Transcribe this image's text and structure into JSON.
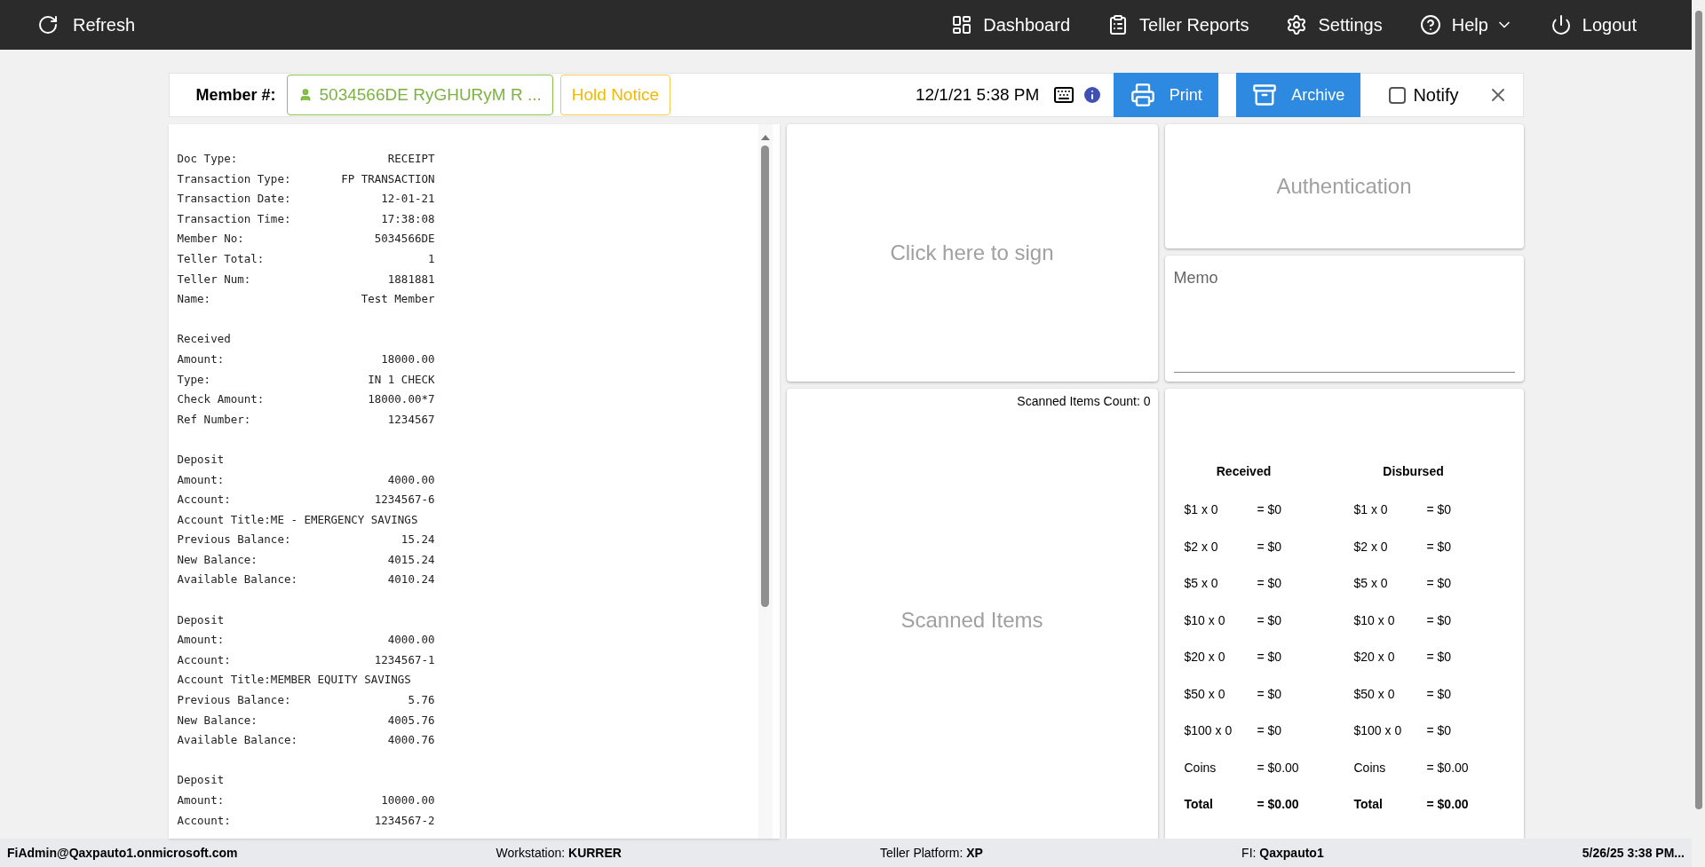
{
  "nav": {
    "refresh": "Refresh",
    "items": [
      {
        "kind": "dashboard",
        "label": "Dashboard"
      },
      {
        "kind": "reports",
        "label": "Teller Reports"
      },
      {
        "kind": "settings",
        "label": "Settings"
      },
      {
        "kind": "help",
        "label": "Help"
      },
      {
        "kind": "logout",
        "label": "Logout"
      }
    ]
  },
  "member_bar": {
    "label": "Member #:",
    "member": "5034566DE RyGHURyM R ...",
    "hold_notice": "Hold Notice",
    "datetime": "12/1/21 5:38 PM",
    "print": "Print",
    "archive": "Archive",
    "notify": {
      "label": "Notify",
      "checked": false
    }
  },
  "receipt": {
    "sections": [
      {
        "lines": [
          {
            "kind": "pair",
            "label": "Doc Type:",
            "value": "RECEIPT"
          },
          {
            "kind": "pair",
            "label": "Transaction Type:",
            "value": "FP TRANSACTION"
          },
          {
            "kind": "pair",
            "label": "Transaction Date:",
            "value": "12-01-21"
          },
          {
            "kind": "pair",
            "label": "Transaction Time:",
            "value": "17:38:08"
          },
          {
            "kind": "pair",
            "label": "Member No:",
            "value": "5034566DE"
          },
          {
            "kind": "pair",
            "label": "Teller Total:",
            "value": "1"
          },
          {
            "kind": "pair",
            "label": "Teller Num:",
            "value": "1881881"
          },
          {
            "kind": "pair",
            "label": "Name:",
            "value": "Test Member"
          }
        ]
      },
      {
        "lines": [
          {
            "kind": "text",
            "text": "Received"
          },
          {
            "kind": "pair",
            "label": "Amount:",
            "value": "18000.00"
          },
          {
            "kind": "pair",
            "label": "Type:",
            "value": "IN 1 CHECK"
          },
          {
            "kind": "pair",
            "label": "Check Amount:",
            "value": "18000.00*7"
          },
          {
            "kind": "pair",
            "label": "Ref Number:",
            "value": "1234567"
          }
        ]
      },
      {
        "lines": [
          {
            "kind": "text",
            "text": "Deposit"
          },
          {
            "kind": "pair",
            "label": "Amount:",
            "value": "4000.00"
          },
          {
            "kind": "pair",
            "label": "Account:",
            "value": "1234567-6"
          },
          {
            "kind": "text",
            "text": "Account Title:ME - EMERGENCY SAVINGS"
          },
          {
            "kind": "pair",
            "label": "Previous Balance:",
            "value": "15.24"
          },
          {
            "kind": "pair",
            "label": "New Balance:",
            "value": "4015.24"
          },
          {
            "kind": "pair",
            "label": "Available Balance:",
            "value": "4010.24"
          }
        ]
      },
      {
        "lines": [
          {
            "kind": "text",
            "text": "Deposit"
          },
          {
            "kind": "pair",
            "label": "Amount:",
            "value": "4000.00"
          },
          {
            "kind": "pair",
            "label": "Account:",
            "value": "1234567-1"
          },
          {
            "kind": "text",
            "text": "Account Title:MEMBER EQUITY SAVINGS"
          },
          {
            "kind": "pair",
            "label": "Previous Balance:",
            "value": "5.76"
          },
          {
            "kind": "pair",
            "label": "New Balance:",
            "value": "4005.76"
          },
          {
            "kind": "pair",
            "label": "Available Balance:",
            "value": "4000.76"
          }
        ]
      },
      {
        "lines": [
          {
            "kind": "text",
            "text": "Deposit"
          },
          {
            "kind": "pair",
            "label": "Amount:",
            "value": "10000.00"
          },
          {
            "kind": "pair",
            "label": "Account:",
            "value": "1234567-2"
          }
        ]
      }
    ]
  },
  "signature": {
    "prompt": "Click here to sign"
  },
  "authentication": {
    "title": "Authentication"
  },
  "memo": {
    "placeholder": "Memo"
  },
  "scanned": {
    "count": "Scanned Items Count: 0",
    "title": "Scanned Items"
  },
  "cash": {
    "columns": [
      {
        "heading": "Received",
        "rows": [
          {
            "kind": "item",
            "label": "$1 x 0",
            "amount": "= $0"
          },
          {
            "kind": "item",
            "label": "$2 x 0",
            "amount": "= $0"
          },
          {
            "kind": "item",
            "label": "$5 x 0",
            "amount": "= $0"
          },
          {
            "kind": "item",
            "label": "$10 x 0",
            "amount": "= $0"
          },
          {
            "kind": "item",
            "label": "$20 x 0",
            "amount": "= $0"
          },
          {
            "kind": "item",
            "label": "$50 x 0",
            "amount": "= $0"
          },
          {
            "kind": "item",
            "label": "$100 x 0",
            "amount": "= $0"
          },
          {
            "kind": "item",
            "label": "Coins",
            "amount": "= $0.00"
          },
          {
            "kind": "total",
            "label": "Total",
            "amount": "= $0.00"
          }
        ]
      },
      {
        "heading": "Disbursed",
        "rows": [
          {
            "kind": "item",
            "label": "$1 x 0",
            "amount": "= $0"
          },
          {
            "kind": "item",
            "label": "$2 x 0",
            "amount": "= $0"
          },
          {
            "kind": "item",
            "label": "$5 x 0",
            "amount": "= $0"
          },
          {
            "kind": "item",
            "label": "$10 x 0",
            "amount": "= $0"
          },
          {
            "kind": "item",
            "label": "$20 x 0",
            "amount": "= $0"
          },
          {
            "kind": "item",
            "label": "$50 x 0",
            "amount": "= $0"
          },
          {
            "kind": "item",
            "label": "$100 x 0",
            "amount": "= $0"
          },
          {
            "kind": "item",
            "label": "Coins",
            "amount": "= $0.00"
          },
          {
            "kind": "total",
            "label": "Total",
            "amount": "= $0.00"
          }
        ]
      }
    ]
  },
  "status_bar": [
    {
      "value": "FiAdmin@Qaxpauto1.onmicrosoft.com"
    },
    {
      "label": "Workstation:",
      "value": "KURRER"
    },
    {
      "label": "Teller Platform:",
      "value": "XP"
    },
    {
      "label": "FI:",
      "value": "Qaxpauto1"
    },
    {
      "value": "5/26/25 3:38 PM..."
    }
  ]
}
